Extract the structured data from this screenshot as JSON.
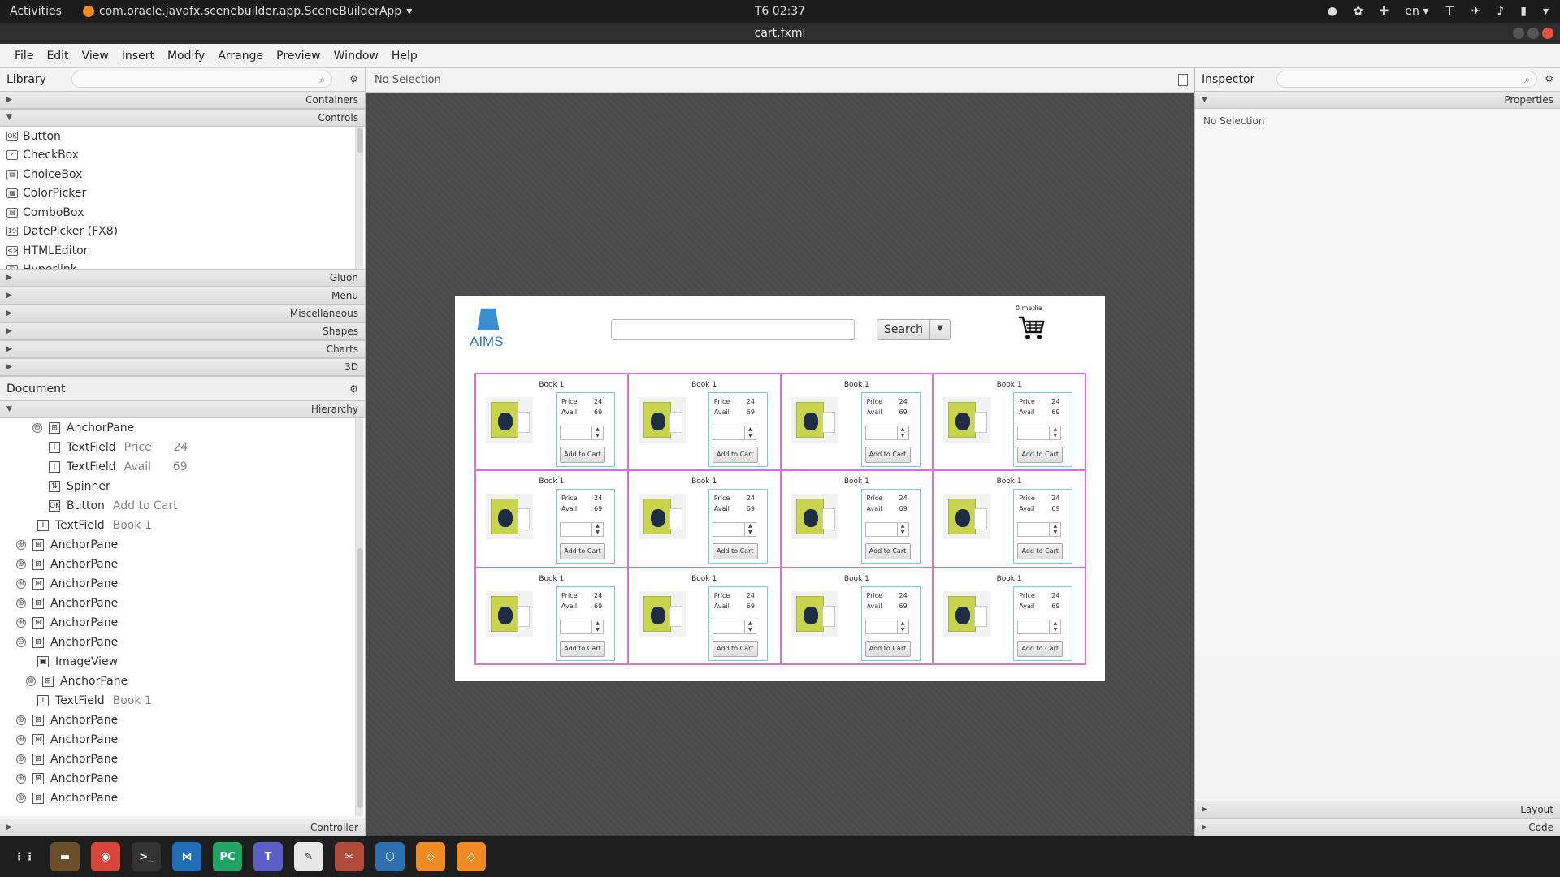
{
  "topbar": {
    "activities": "Activities",
    "app_name": "com.oracle.javafx.scenebuilder.app.SceneBuilderApp",
    "clock": "T6 02:37",
    "lang": "en"
  },
  "window": {
    "title": "cart.fxml"
  },
  "menu": [
    "File",
    "Edit",
    "View",
    "Insert",
    "Modify",
    "Arrange",
    "Preview",
    "Window",
    "Help"
  ],
  "library": {
    "title": "Library",
    "sections_top": [
      "Containers",
      "Controls"
    ],
    "controls": [
      {
        "icon": "OK",
        "label": "Button"
      },
      {
        "icon": "✓",
        "label": "CheckBox"
      },
      {
        "icon": "▤",
        "label": "ChoiceBox"
      },
      {
        "icon": "▦",
        "label": "ColorPicker"
      },
      {
        "icon": "▤",
        "label": "ComboBox"
      },
      {
        "icon": "19",
        "label": "DatePicker  (FX8)"
      },
      {
        "icon": "<>",
        "label": "HTMLEditor"
      },
      {
        "icon": "⎘",
        "label": "Hyperlink"
      }
    ],
    "sections_bottom": [
      "Gluon",
      "Menu",
      "Miscellaneous",
      "Shapes",
      "Charts",
      "3D"
    ]
  },
  "document": {
    "title": "Document",
    "hierarchy_label": "Hierarchy",
    "controller_label": "Controller",
    "rows": [
      {
        "indent": 40,
        "exp": "⊖",
        "icon": "⊞",
        "label": "AnchorPane",
        "value": ""
      },
      {
        "indent": 60,
        "exp": "",
        "icon": "I",
        "label": "TextField",
        "value": "Price      24"
      },
      {
        "indent": 60,
        "exp": "",
        "icon": "I",
        "label": "TextField",
        "value": "Avail      69"
      },
      {
        "indent": 60,
        "exp": "",
        "icon": "⇅",
        "label": "Spinner",
        "value": ""
      },
      {
        "indent": 60,
        "exp": "",
        "icon": "OK",
        "label": "Button",
        "value": "Add to Cart"
      },
      {
        "indent": 46,
        "exp": "",
        "icon": "I",
        "label": "TextField",
        "value": "Book 1"
      },
      {
        "indent": 20,
        "exp": "⊕",
        "icon": "⊞",
        "label": "AnchorPane",
        "value": ""
      },
      {
        "indent": 20,
        "exp": "⊕",
        "icon": "⊞",
        "label": "AnchorPane",
        "value": ""
      },
      {
        "indent": 20,
        "exp": "⊕",
        "icon": "⊞",
        "label": "AnchorPane",
        "value": ""
      },
      {
        "indent": 20,
        "exp": "⊕",
        "icon": "⊞",
        "label": "AnchorPane",
        "value": ""
      },
      {
        "indent": 20,
        "exp": "⊕",
        "icon": "⊞",
        "label": "AnchorPane",
        "value": ""
      },
      {
        "indent": 20,
        "exp": "⊖",
        "icon": "⊞",
        "label": "AnchorPane",
        "value": ""
      },
      {
        "indent": 46,
        "exp": "",
        "icon": "▣",
        "label": "ImageView",
        "value": ""
      },
      {
        "indent": 32,
        "exp": "⊕",
        "icon": "⊞",
        "label": "AnchorPane",
        "value": ""
      },
      {
        "indent": 46,
        "exp": "",
        "icon": "I",
        "label": "TextField",
        "value": "Book 1"
      },
      {
        "indent": 20,
        "exp": "⊕",
        "icon": "⊞",
        "label": "AnchorPane",
        "value": ""
      },
      {
        "indent": 20,
        "exp": "⊕",
        "icon": "⊞",
        "label": "AnchorPane",
        "value": ""
      },
      {
        "indent": 20,
        "exp": "⊕",
        "icon": "⊞",
        "label": "AnchorPane",
        "value": ""
      },
      {
        "indent": 20,
        "exp": "⊕",
        "icon": "⊞",
        "label": "AnchorPane",
        "value": ""
      },
      {
        "indent": 20,
        "exp": "⊕",
        "icon": "⊞",
        "label": "AnchorPane",
        "value": ""
      }
    ]
  },
  "canvas": {
    "selection": "No Selection",
    "logo_text": "AIMS",
    "search_button": "Search",
    "media_count": "0 media",
    "items": [
      {
        "title": "Book 1",
        "price_label": "Price",
        "price": "24",
        "avail_label": "Avail",
        "avail": "69",
        "button": "Add to Cart"
      },
      {
        "title": "Book 1",
        "price_label": "Price",
        "price": "24",
        "avail_label": "Avail",
        "avail": "69",
        "button": "Add to Cart"
      },
      {
        "title": "Book 1",
        "price_label": "Price",
        "price": "24",
        "avail_label": "Avail",
        "avail": "69",
        "button": "Add to Cart"
      },
      {
        "title": "Book 1",
        "price_label": "Price",
        "price": "24",
        "avail_label": "Avail",
        "avail": "69",
        "button": "Add to Cart"
      },
      {
        "title": "Book 1",
        "price_label": "Price",
        "price": "24",
        "avail_label": "Avail",
        "avail": "69",
        "button": "Add to Cart"
      },
      {
        "title": "Book 1",
        "price_label": "Price",
        "price": "24",
        "avail_label": "Avail",
        "avail": "69",
        "button": "Add to Cart"
      },
      {
        "title": "Book 1",
        "price_label": "Price",
        "price": "24",
        "avail_label": "Avail",
        "avail": "69",
        "button": "Add to Cart"
      },
      {
        "title": "Book 1",
        "price_label": "Price",
        "price": "24",
        "avail_label": "Avail",
        "avail": "69",
        "button": "Add to Cart"
      },
      {
        "title": "Book 1",
        "price_label": "Price",
        "price": "24",
        "avail_label": "Avail",
        "avail": "69",
        "button": "Add to Cart"
      },
      {
        "title": "Book 1",
        "price_label": "Price",
        "price": "24",
        "avail_label": "Avail",
        "avail": "69",
        "button": "Add to Cart"
      },
      {
        "title": "Book 1",
        "price_label": "Price",
        "price": "24",
        "avail_label": "Avail",
        "avail": "69",
        "button": "Add to Cart"
      },
      {
        "title": "Book 1",
        "price_label": "Price",
        "price": "24",
        "avail_label": "Avail",
        "avail": "69",
        "button": "Add to Cart"
      }
    ]
  },
  "inspector": {
    "title": "Inspector",
    "properties": "Properties",
    "no_selection": "No Selection",
    "layout": "Layout",
    "code": "Code"
  },
  "taskbar": [
    {
      "name": "apps-grid-icon",
      "glyph": "⋮⋮",
      "color": "#1e1e1e"
    },
    {
      "name": "files-icon",
      "glyph": "▬",
      "color": "#6b4f2a"
    },
    {
      "name": "chrome-icon",
      "glyph": "◉",
      "color": "#d8453a"
    },
    {
      "name": "terminal-icon",
      "glyph": ">_",
      "color": "#333333"
    },
    {
      "name": "vscode-icon",
      "glyph": "⋈",
      "color": "#1e6fb8"
    },
    {
      "name": "pycharm-icon",
      "glyph": "PC",
      "color": "#21a366"
    },
    {
      "name": "teams-icon",
      "glyph": "T",
      "color": "#5b5fc7"
    },
    {
      "name": "text-editor-icon",
      "glyph": "✎",
      "color": "#e8e8e8"
    },
    {
      "name": "tools-icon",
      "glyph": "✂",
      "color": "#b04a3a"
    },
    {
      "name": "virtualbox-icon",
      "glyph": "⬡",
      "color": "#2c6fb0"
    },
    {
      "name": "scenebuilder-icon",
      "glyph": "◇",
      "color": "#f08a24"
    },
    {
      "name": "scenebuilder-active-icon",
      "glyph": "◇",
      "color": "#f08a24"
    }
  ]
}
